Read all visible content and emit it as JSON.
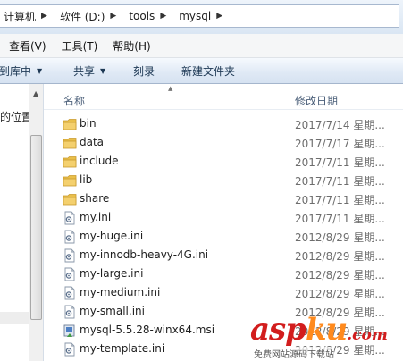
{
  "address_bar": {
    "crumbs": [
      "计算机",
      "软件 (D:)",
      "tools",
      "mysql"
    ]
  },
  "menu": {
    "items": [
      "查看(V)",
      "工具(T)",
      "帮助(H)"
    ]
  },
  "toolbar": {
    "include_library": "到库中",
    "share": "共享",
    "burn": "刻录",
    "new_folder": "新建文件夹"
  },
  "nav": {
    "partial_label": "的位置"
  },
  "columns": {
    "name": "名称",
    "date_modified": "修改日期"
  },
  "files": [
    {
      "name": "bin",
      "date": "2017/7/14 星期...",
      "icon": "folder-icon"
    },
    {
      "name": "data",
      "date": "2017/7/17 星期...",
      "icon": "folder-icon"
    },
    {
      "name": "include",
      "date": "2017/7/11 星期...",
      "icon": "folder-icon"
    },
    {
      "name": "lib",
      "date": "2017/7/11 星期...",
      "icon": "folder-icon"
    },
    {
      "name": "share",
      "date": "2017/7/11 星期...",
      "icon": "folder-icon"
    },
    {
      "name": "my.ini",
      "date": "2017/7/11 星期...",
      "icon": "ini-file-icon"
    },
    {
      "name": "my-huge.ini",
      "date": "2012/8/29 星期...",
      "icon": "ini-file-icon"
    },
    {
      "name": "my-innodb-heavy-4G.ini",
      "date": "2012/8/29 星期...",
      "icon": "ini-file-icon"
    },
    {
      "name": "my-large.ini",
      "date": "2012/8/29 星期...",
      "icon": "ini-file-icon"
    },
    {
      "name": "my-medium.ini",
      "date": "2012/8/29 星期...",
      "icon": "ini-file-icon"
    },
    {
      "name": "my-small.ini",
      "date": "2012/8/29 星期...",
      "icon": "ini-file-icon"
    },
    {
      "name": "mysql-5.5.28-winx64.msi",
      "date": "2012/8/29 星期...",
      "icon": "msi-installer-icon"
    },
    {
      "name": "my-template.ini",
      "date": "2012/8/29 星期...",
      "icon": "ini-file-icon"
    }
  ],
  "watermark": {
    "logo_main": "asp",
    "logo_accent": "ku",
    "logo_suffix": ".com",
    "subtitle": "免费网站源码下载站"
  },
  "colors": {
    "folder": "#e9bf4a",
    "watermark_red": "#d21d1d",
    "watermark_orange": "#ff8a1d"
  }
}
